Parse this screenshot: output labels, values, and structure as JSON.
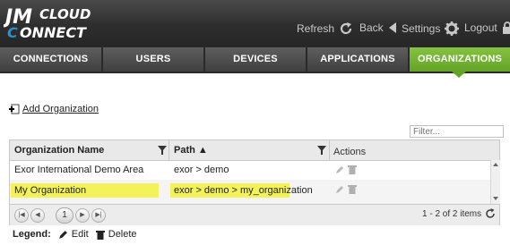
{
  "header": {
    "logo_text": "JMCLOUD CONNECT",
    "refresh_label": "Refresh",
    "back_label": "Back",
    "settings_label": "Settings",
    "logout_label": "Logout"
  },
  "tabs": [
    {
      "label": "CONNECTIONS",
      "active": false
    },
    {
      "label": "USERS",
      "active": false
    },
    {
      "label": "DEVICES",
      "active": false
    },
    {
      "label": "APPLICATIONS",
      "active": false
    },
    {
      "label": "ORGANIZATIONS",
      "active": true
    }
  ],
  "accent_color": "#6cab2c",
  "highlight_color": "#f3f25a",
  "toolbar": {
    "add_label": "Add Organization"
  },
  "filter": {
    "placeholder": "Filter..."
  },
  "grid": {
    "columns": [
      {
        "label": "Organization Name"
      },
      {
        "label": "Path ▲"
      },
      {
        "label": "Actions"
      }
    ],
    "rows": [
      {
        "name": "Exor International Demo Area",
        "path": "exor > demo"
      },
      {
        "name": "My Organization",
        "path": "exor > demo > my_organization"
      }
    ],
    "pager": {
      "current_page": "1",
      "info": "1 - 2 of 2 items"
    }
  },
  "legend": {
    "title": "Legend:",
    "edit_label": "Edit",
    "delete_label": "Delete"
  }
}
